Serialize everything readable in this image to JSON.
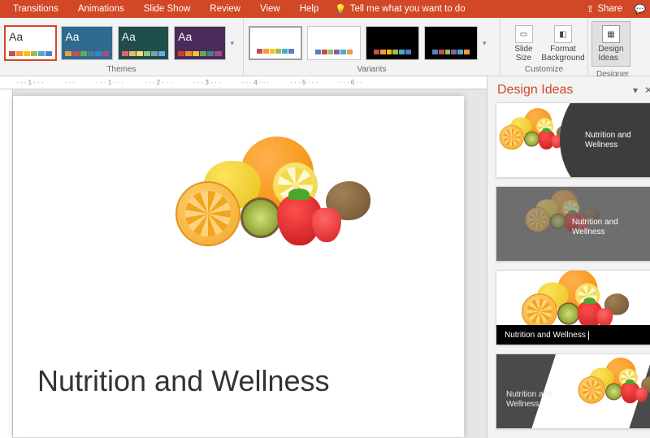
{
  "ribbon": {
    "tabs": [
      "Transitions",
      "Animations",
      "Slide Show",
      "Review",
      "View",
      "Help"
    ],
    "tellme": "Tell me what you want to do",
    "share": "Share"
  },
  "groups": {
    "themes": "Themes",
    "variants": "Variants",
    "customize": "Customize",
    "designer": "Designer"
  },
  "customize": {
    "slideSize": "Slide\nSize",
    "formatBg": "Format\nBackground",
    "designIdeas": "Design\nIdeas"
  },
  "slide": {
    "title": "Nutrition and Wellness"
  },
  "pane": {
    "title": "Design Ideas",
    "ideaLabel": "Nutrition and Wellness",
    "ideaLabel3": "Nutrition and Wellness"
  },
  "ruler": [
    "1",
    "",
    "1",
    "",
    "2",
    "",
    "3",
    "",
    "4",
    "",
    "5",
    "",
    "6"
  ]
}
